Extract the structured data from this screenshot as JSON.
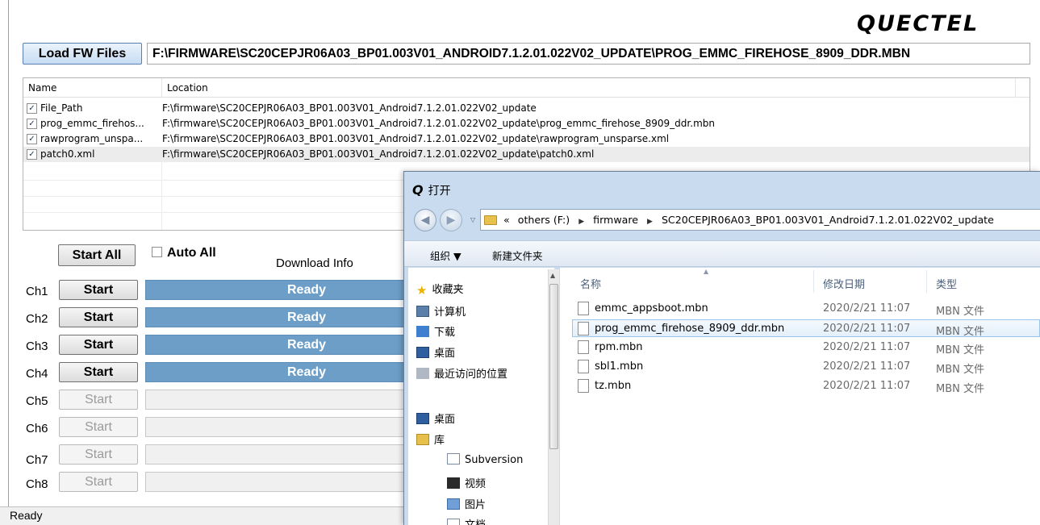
{
  "app": {
    "logo": "QUECTEL",
    "load_button": "Load FW Files",
    "fw_path": "F:\\FIRMWARE\\SC20CEPJR06A03_BP01.003V01_ANDROID7.1.2.01.022V02_UPDATE\\PROG_EMMC_FIREHOSE_8909_DDR.MBN",
    "file_list": {
      "columns": [
        "Name",
        "Location"
      ],
      "rows": [
        {
          "checked": true,
          "name": "File_Path",
          "location": "F:\\firmware\\SC20CEPJR06A03_BP01.003V01_Android7.1.2.01.022V02_update"
        },
        {
          "checked": true,
          "name": "prog_emmc_firehos...",
          "location": "F:\\firmware\\SC20CEPJR06A03_BP01.003V01_Android7.1.2.01.022V02_update\\prog_emmc_firehose_8909_ddr.mbn"
        },
        {
          "checked": true,
          "name": "rawprogram_unspa...",
          "location": "F:\\firmware\\SC20CEPJR06A03_BP01.003V01_Android7.1.2.01.022V02_update\\rawprogram_unsparse.xml"
        },
        {
          "checked": true,
          "name": "patch0.xml",
          "location": "F:\\firmware\\SC20CEPJR06A03_BP01.003V01_Android7.1.2.01.022V02_update\\patch0.xml"
        }
      ]
    },
    "start_all": "Start All",
    "auto_all": "Auto All",
    "download_info": "Download Info",
    "channels": [
      {
        "label": "Ch1",
        "button": "Start",
        "enabled": true,
        "status": "Ready"
      },
      {
        "label": "Ch2",
        "button": "Start",
        "enabled": true,
        "status": "Ready"
      },
      {
        "label": "Ch3",
        "button": "Start",
        "enabled": true,
        "status": "Ready"
      },
      {
        "label": "Ch4",
        "button": "Start",
        "enabled": true,
        "status": "Ready"
      },
      {
        "label": "Ch5",
        "button": "Start",
        "enabled": false,
        "status": ""
      },
      {
        "label": "Ch6",
        "button": "Start",
        "enabled": false,
        "status": ""
      },
      {
        "label": "Ch7",
        "button": "Start",
        "enabled": false,
        "status": ""
      },
      {
        "label": "Ch8",
        "button": "Start",
        "enabled": false,
        "status": ""
      }
    ],
    "status_bar": "Ready",
    "colors": {
      "progress_ready": "#6c9ec8",
      "load_button": "#c7dcf3"
    }
  },
  "dialog": {
    "title": "打开",
    "title_icon": "quectel-q-icon",
    "address": {
      "prefix": "«",
      "crumbs": [
        "others (F:)",
        "firmware",
        "SC20CEPJR06A03_BP01.003V01_Android7.1.2.01.022V02_update"
      ]
    },
    "toolbar": {
      "organize": "组织 ▼",
      "new_folder": "新建文件夹"
    },
    "nav": [
      {
        "label": "收藏夹",
        "icon": "star-icon",
        "sub": false
      },
      {
        "label": "计算机",
        "icon": "computer-icon",
        "sub": false
      },
      {
        "label": "下载",
        "icon": "download-icon",
        "sub": false
      },
      {
        "label": "桌面",
        "icon": "desktop-icon",
        "sub": false
      },
      {
        "label": "最近访问的位置",
        "icon": "recent-places-icon",
        "sub": false
      },
      {
        "label": "桌面",
        "icon": "desktop-icon",
        "sub": false
      },
      {
        "label": "库",
        "icon": "library-icon",
        "sub": false
      },
      {
        "label": "Subversion",
        "icon": "document-icon",
        "sub": true
      },
      {
        "label": "视频",
        "icon": "video-icon",
        "sub": true
      },
      {
        "label": "图片",
        "icon": "pictures-icon",
        "sub": true
      },
      {
        "label": "文档",
        "icon": "document-icon",
        "sub": true
      }
    ],
    "columns": {
      "name": "名称",
      "date": "修改日期",
      "type": "类型"
    },
    "files": [
      {
        "name": "emmc_appsboot.mbn",
        "date": "2020/2/21 11:07",
        "type": "MBN 文件",
        "selected": false
      },
      {
        "name": "prog_emmc_firehose_8909_ddr.mbn",
        "date": "2020/2/21 11:07",
        "type": "MBN 文件",
        "selected": true
      },
      {
        "name": "rpm.mbn",
        "date": "2020/2/21 11:07",
        "type": "MBN 文件",
        "selected": false
      },
      {
        "name": "sbl1.mbn",
        "date": "2020/2/21 11:07",
        "type": "MBN 文件",
        "selected": false
      },
      {
        "name": "tz.mbn",
        "date": "2020/2/21 11:07",
        "type": "MBN 文件",
        "selected": false
      }
    ]
  }
}
